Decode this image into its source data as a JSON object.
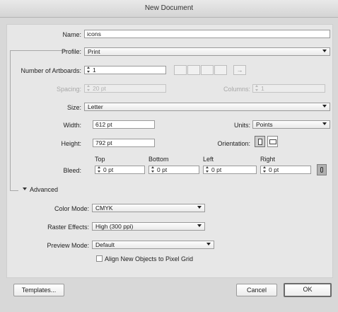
{
  "window": {
    "title": "New Document"
  },
  "name": {
    "label": "Name:",
    "value": "icons"
  },
  "profile": {
    "label": "Profile:",
    "value": "Print"
  },
  "artboards": {
    "label": "Number of Artboards:",
    "value": "1",
    "arrange_arrow": "→"
  },
  "spacing": {
    "label": "Spacing:",
    "value": "20 pt"
  },
  "columns": {
    "label": "Columns:",
    "value": "1"
  },
  "size": {
    "label": "Size:",
    "value": "Letter"
  },
  "width": {
    "label": "Width:",
    "value": "612 pt"
  },
  "units": {
    "label": "Units:",
    "value": "Points"
  },
  "height": {
    "label": "Height:",
    "value": "792 pt"
  },
  "orientation": {
    "label": "Orientation:"
  },
  "bleed": {
    "label": "Bleed:",
    "top": {
      "label": "Top",
      "value": "0 pt"
    },
    "bottom": {
      "label": "Bottom",
      "value": "0 pt"
    },
    "left": {
      "label": "Left",
      "value": "0 pt"
    },
    "right": {
      "label": "Right",
      "value": "0 pt"
    }
  },
  "advanced": {
    "label": "Advanced",
    "color_mode": {
      "label": "Color Mode:",
      "value": "CMYK"
    },
    "raster_effects": {
      "label": "Raster Effects:",
      "value": "High (300 ppi)"
    },
    "preview_mode": {
      "label": "Preview Mode:",
      "value": "Default"
    },
    "align_pixel_grid": {
      "label": "Align New Objects to Pixel Grid",
      "checked": false
    }
  },
  "buttons": {
    "templates": "Templates...",
    "cancel": "Cancel",
    "ok": "OK"
  },
  "colors": {
    "background": "#d8d8d8",
    "panel": "#e7e7e7"
  }
}
